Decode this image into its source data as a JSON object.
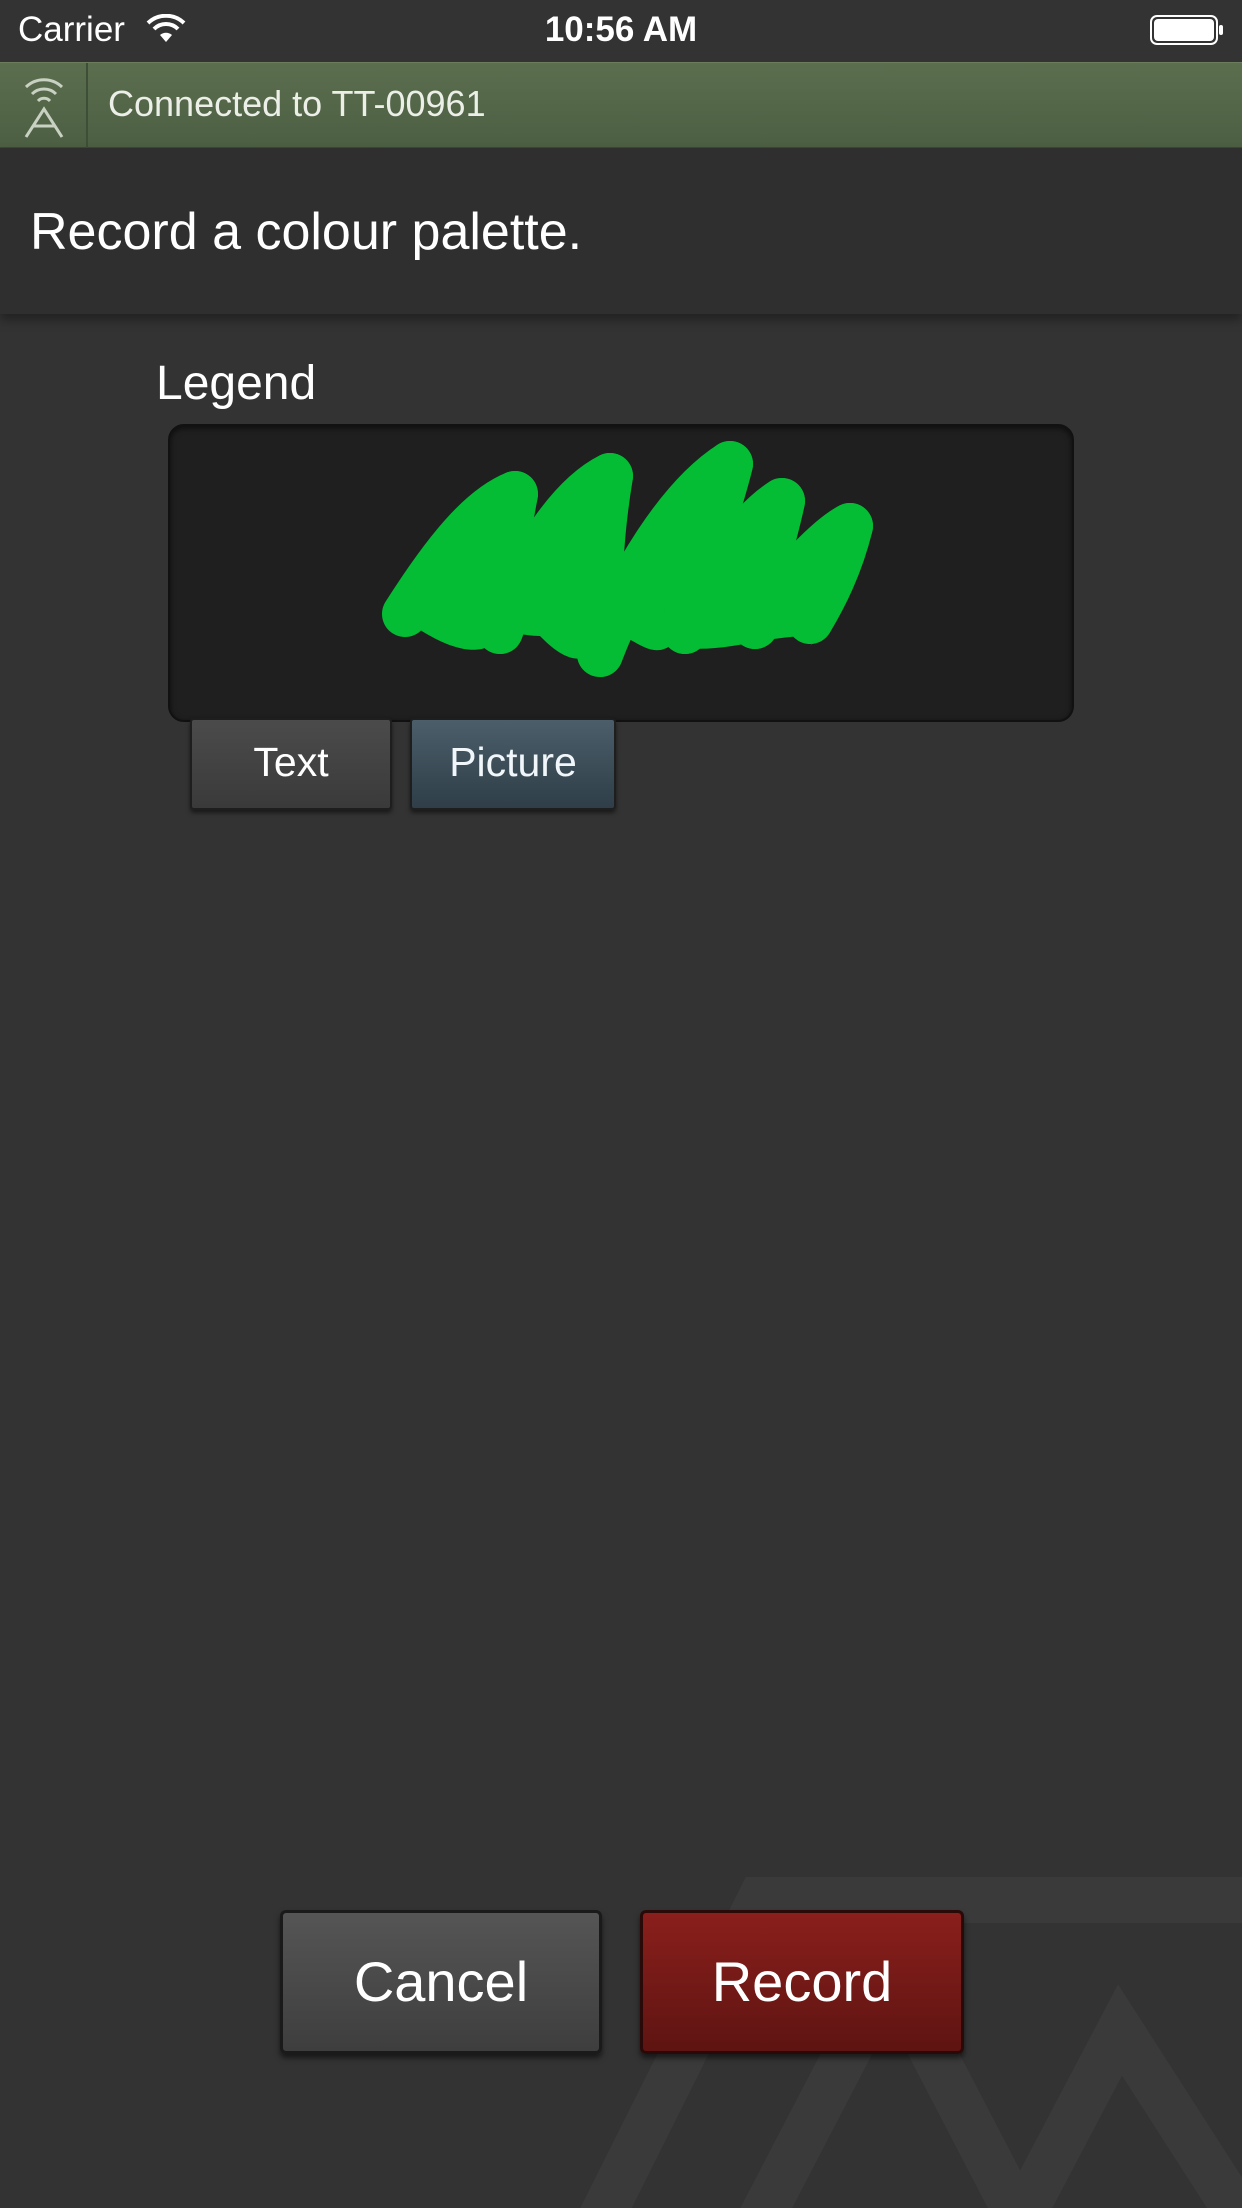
{
  "status_bar": {
    "carrier": "Carrier",
    "time": "10:56 AM"
  },
  "connection": {
    "text": "Connected to TT-00961",
    "icon": "wireless-antenna-icon"
  },
  "header": {
    "title": "Record a colour palette."
  },
  "legend": {
    "label": "Legend",
    "scribble_color": "#04bd34",
    "tabs": {
      "text_label": "Text",
      "picture_label": "Picture",
      "selected": "Picture"
    }
  },
  "actions": {
    "cancel_label": "Cancel",
    "record_label": "Record"
  },
  "colors": {
    "banner": "#566a4a",
    "background": "#333333",
    "record_button": "#7a1b18",
    "picture_tab": "#42535e"
  }
}
